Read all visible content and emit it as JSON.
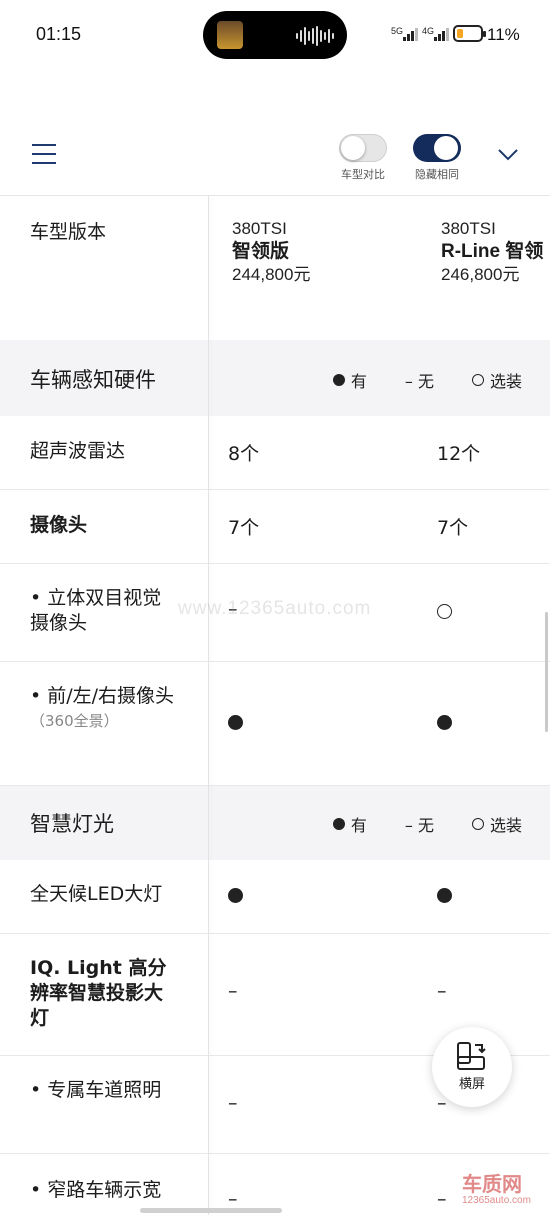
{
  "status_bar": {
    "time": "01:15",
    "network_1": "5G",
    "network_2": "4G",
    "battery": "11%"
  },
  "header": {
    "toggle_compare_label": "车型对比",
    "toggle_hide_same_label": "隐藏相同"
  },
  "version": {
    "label": "车型版本",
    "col1": {
      "model": "380TSI",
      "name": "智领版",
      "price": "244,800元"
    },
    "col2": {
      "model": "380TSI",
      "name": "R-Line 智领",
      "price": "246,800元"
    }
  },
  "legend": {
    "yes": "有",
    "none": "– 无",
    "optional": "选装"
  },
  "sections": [
    {
      "title": "车辆感知硬件",
      "rows": [
        {
          "label": "超声波雷达",
          "col1": "8个",
          "col2": "12个"
        },
        {
          "label": "摄像头",
          "col1": "7个",
          "col2": "7个"
        },
        {
          "label": "•  立体双目视觉摄像头",
          "col1": "–",
          "col2": "optional"
        },
        {
          "label": "•  前/左/右摄像头",
          "sub": "（360全景）",
          "col1": "yes",
          "col2": "yes"
        }
      ]
    },
    {
      "title": "智慧灯光",
      "rows": [
        {
          "label": "全天候LED大灯",
          "col1": "yes",
          "col2": "yes"
        },
        {
          "label": "IQ. Light 高分辨率智慧投影大灯",
          "col1": "–",
          "col2": "–"
        },
        {
          "label": "•  专属车道照明",
          "col1": "–",
          "col2": "–"
        },
        {
          "label": "•  窄路车辆示宽",
          "col1": "–",
          "col2": "–"
        }
      ]
    }
  ],
  "watermark": "www.12365auto.com",
  "fab": {
    "label": "横屏"
  },
  "logo": {
    "text": "车质网",
    "sub": "12365auto.com"
  }
}
